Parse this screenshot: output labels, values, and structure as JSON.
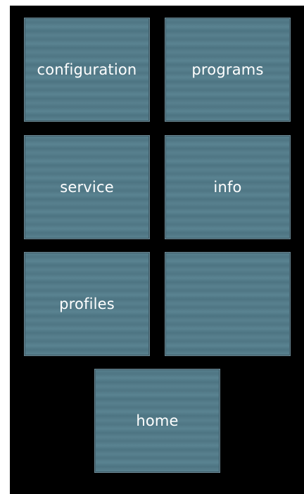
{
  "menu": {
    "tiles": [
      {
        "label": "configuration"
      },
      {
        "label": "programs"
      },
      {
        "label": "service"
      },
      {
        "label": "info"
      },
      {
        "label": "profiles"
      },
      {
        "label": ""
      },
      {
        "label": "home"
      }
    ]
  },
  "colors": {
    "background": "#000000",
    "tile": "#54808e",
    "tile_border": "#6c8a96",
    "text": "#ffffff"
  }
}
